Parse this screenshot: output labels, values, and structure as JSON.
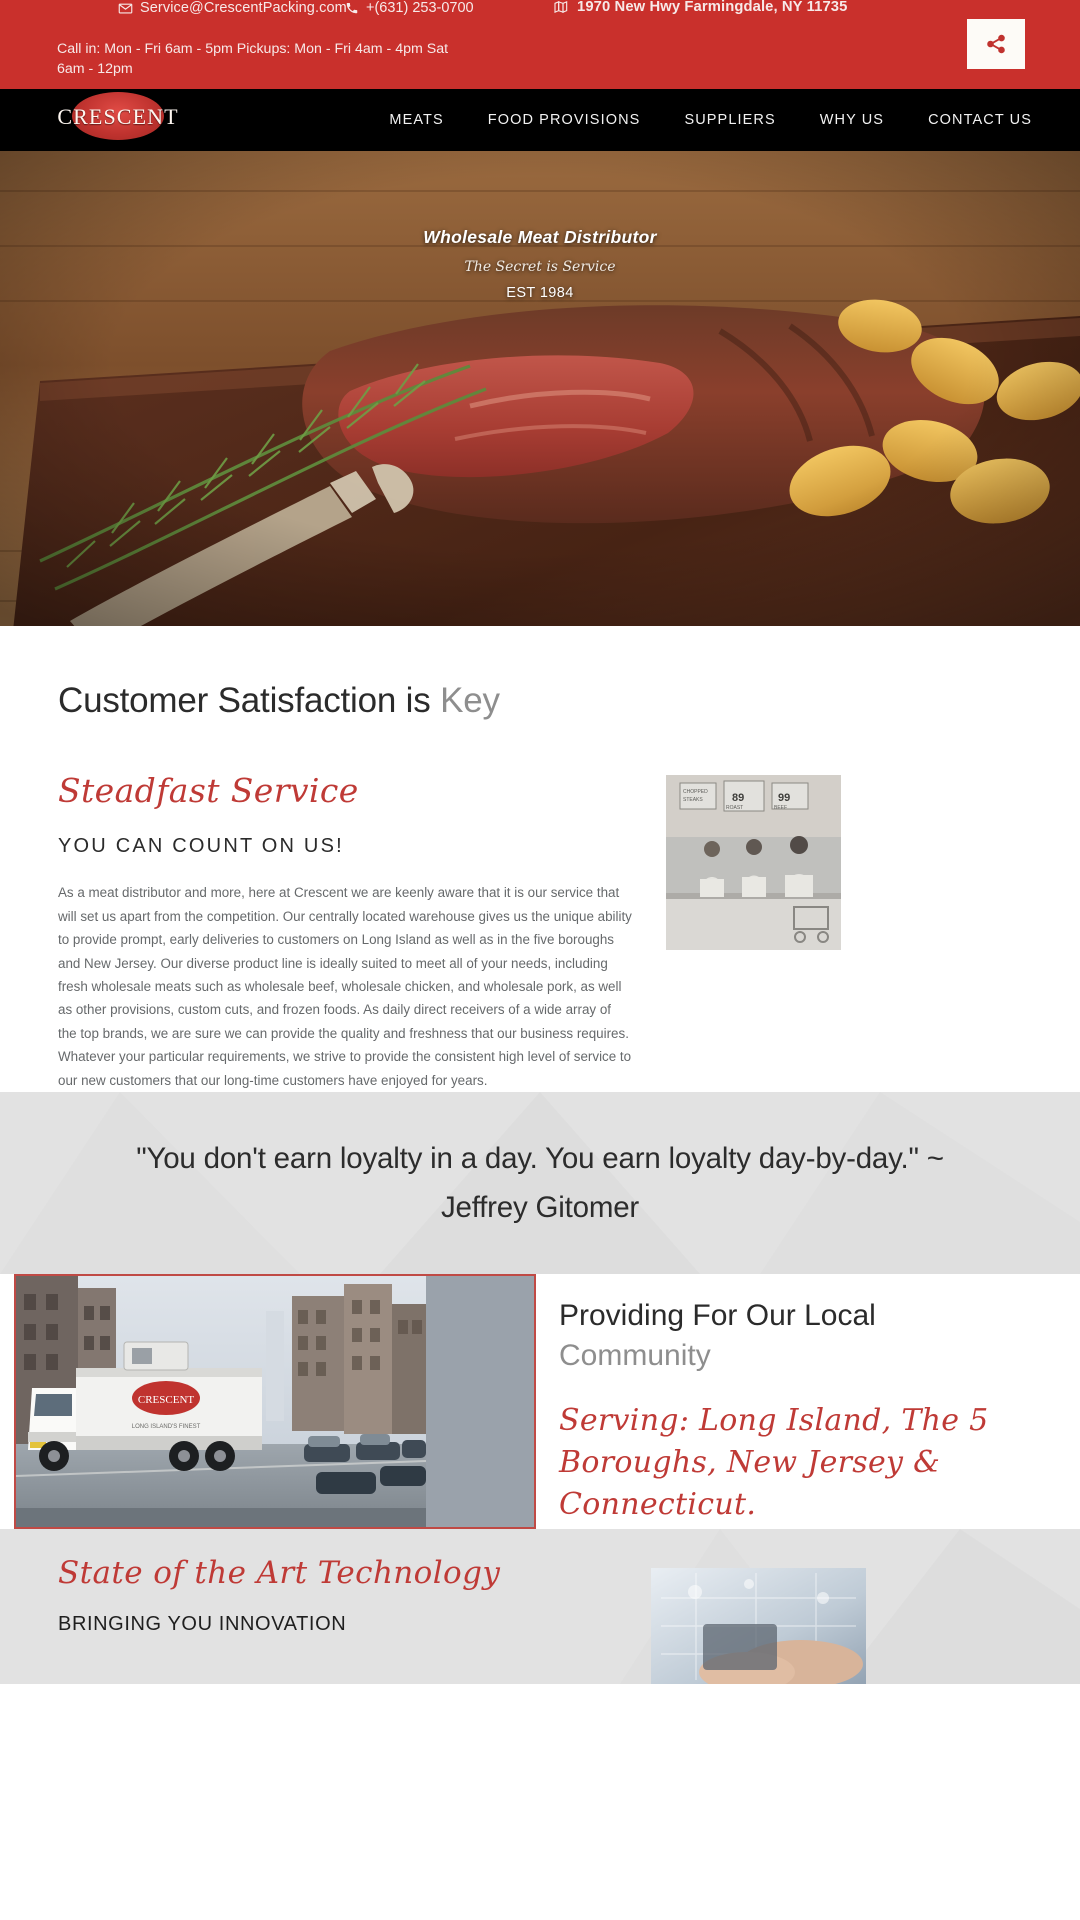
{
  "topbar": {
    "email": "Service@CrescentPacking.com",
    "email_icon": "envelope-icon",
    "phone": "+(631) 253-0700",
    "phone_icon": "phone-icon",
    "address": "1970 New Hwy Farmingdale, NY 11735",
    "address_icon": "map-icon",
    "hours": "Call in: Mon - Fri  6am - 5pm  Pickups: Mon - Fri  4am - 4pm  Sat  6am - 12pm",
    "share_icon": "share-icon",
    "bg_color": "#c9302c",
    "share_icon_color": "#c0332f"
  },
  "nav": {
    "logo_text": "CRESCENT",
    "items": [
      {
        "label": "MEATS"
      },
      {
        "label": "FOOD PROVISIONS"
      },
      {
        "label": "SUPPLIERS"
      },
      {
        "label": "WHY  US"
      },
      {
        "label": "CONTACT US"
      }
    ],
    "bg_color": "#000000"
  },
  "hero": {
    "line1": "Wholesale Meat Distributor",
    "line2": "The Secret is Service",
    "line3": "EST 1984",
    "image_alt": "grilled-steak-on-wooden-board"
  },
  "satisfaction": {
    "title_main": "Customer Satisfaction is ",
    "title_accent": "Key",
    "script_heading": "Steadfast Service",
    "sub_heading": "YOU CAN COUNT ON US!",
    "paragraph": "As a meat distributor and more, here at Crescent we are keenly aware that it is our service that will set us apart from the competition. Our centrally located warehouse gives us the unique ability to provide prompt, early deliveries to customers on Long Island as well as in the five boroughs and New Jersey. Our diverse product line is ideally suited to meet all of your needs, including fresh wholesale meats such as wholesale beef, wholesale chicken, and wholesale pork, as well as other provisions, custom cuts, and frozen foods. As daily direct receivers of a wide array of the top brands, we are sure we can provide the quality and freshness that our business requires. Whatever your particular requirements, we strive to provide the consistent high level of service to our new customers that our long-time customers have enjoyed for years.",
    "photo_alt": "vintage-butcher-shop-staff-photo",
    "accent_color": "#bf3a36"
  },
  "quote": {
    "text": "\"You don't earn loyalty in a day. You earn loyalty day-by-day.\" ~ Jeffrey Gitomer",
    "bg_color": "#e2e2e2"
  },
  "community": {
    "heading_main": "Providing For Our Local",
    "heading_accent": "Community",
    "script_text": "Serving: Long Island, The 5 Boroughs, New Jersey & Connecticut.",
    "photo_alt": "crescent-delivery-truck-city-street",
    "border_color": "#c04a45"
  },
  "technology": {
    "script_heading": "State of the Art Technology",
    "sub_heading": "BRINGING YOU INNOVATION",
    "photo_alt": "technology-hands-tablet",
    "bg_color": "#e2e2e2"
  }
}
